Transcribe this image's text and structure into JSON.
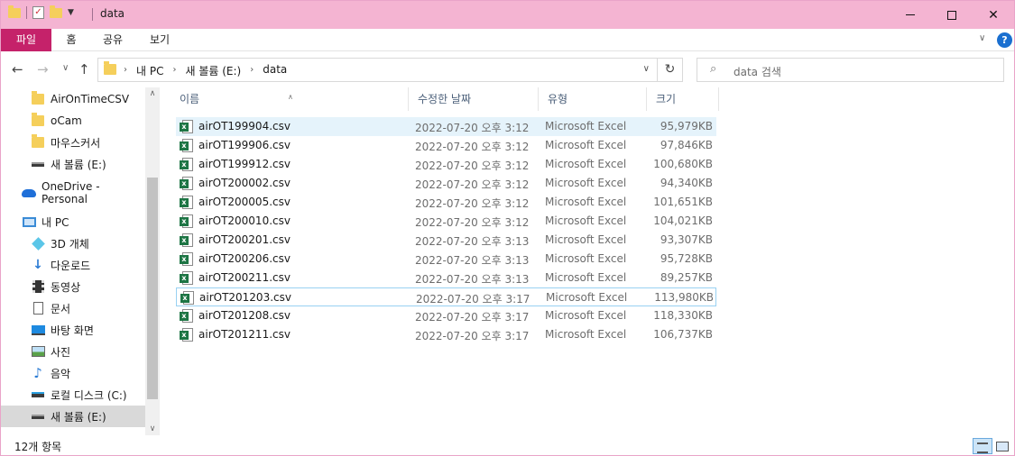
{
  "window": {
    "title": "data",
    "colors": {
      "titlebar": "#f4b4d2",
      "file_tab": "#c5226a",
      "excel_green": "#1d7544"
    }
  },
  "ribbon": {
    "file": "파일",
    "tabs": [
      "홈",
      "공유",
      "보기"
    ],
    "help": "?"
  },
  "address": {
    "crumbs": [
      "내 PC",
      "새 볼륨 (E:)",
      "data"
    ]
  },
  "search": {
    "placeholder": "data 검색"
  },
  "nav": {
    "items": [
      {
        "label": "AirOnTimeCSV",
        "icon": "folder-icon"
      },
      {
        "label": "oCam",
        "icon": "folder-icon"
      },
      {
        "label": "마우스커서",
        "icon": "folder-icon"
      },
      {
        "label": "새 볼륨 (E:)",
        "icon": "drive-icon"
      },
      {
        "label": "OneDrive - Personal",
        "icon": "onedrive-icon"
      },
      {
        "label": "내 PC",
        "icon": "pc-icon"
      },
      {
        "label": "3D 개체",
        "icon": "3d-objects-icon"
      },
      {
        "label": "다운로드",
        "icon": "downloads-icon"
      },
      {
        "label": "동영상",
        "icon": "videos-icon"
      },
      {
        "label": "문서",
        "icon": "documents-icon"
      },
      {
        "label": "바탕 화면",
        "icon": "desktop-icon"
      },
      {
        "label": "사진",
        "icon": "pictures-icon"
      },
      {
        "label": "음악",
        "icon": "music-icon"
      },
      {
        "label": "로컬 디스크 (C:)",
        "icon": "local-disk-icon"
      },
      {
        "label": "새 볼륨 (E:)",
        "icon": "drive-icon"
      }
    ]
  },
  "columns": {
    "name": "이름",
    "date": "수정한 날짜",
    "type": "유형",
    "size": "크기"
  },
  "files": [
    {
      "name": "airOT199904.csv",
      "date": "2022-07-20 오후 3:12",
      "type": "Microsoft Excel ...",
      "size": "95,979KB"
    },
    {
      "name": "airOT199906.csv",
      "date": "2022-07-20 오후 3:12",
      "type": "Microsoft Excel ...",
      "size": "97,846KB"
    },
    {
      "name": "airOT199912.csv",
      "date": "2022-07-20 오후 3:12",
      "type": "Microsoft Excel ...",
      "size": "100,680KB"
    },
    {
      "name": "airOT200002.csv",
      "date": "2022-07-20 오후 3:12",
      "type": "Microsoft Excel ...",
      "size": "94,340KB"
    },
    {
      "name": "airOT200005.csv",
      "date": "2022-07-20 오후 3:12",
      "type": "Microsoft Excel ...",
      "size": "101,651KB"
    },
    {
      "name": "airOT200010.csv",
      "date": "2022-07-20 오후 3:12",
      "type": "Microsoft Excel ...",
      "size": "104,021KB"
    },
    {
      "name": "airOT200201.csv",
      "date": "2022-07-20 오후 3:13",
      "type": "Microsoft Excel ...",
      "size": "93,307KB"
    },
    {
      "name": "airOT200206.csv",
      "date": "2022-07-20 오후 3:13",
      "type": "Microsoft Excel ...",
      "size": "95,728KB"
    },
    {
      "name": "airOT200211.csv",
      "date": "2022-07-20 오후 3:13",
      "type": "Microsoft Excel ...",
      "size": "89,257KB"
    },
    {
      "name": "airOT201203.csv",
      "date": "2022-07-20 오후 3:17",
      "type": "Microsoft Excel ...",
      "size": "113,980KB"
    },
    {
      "name": "airOT201208.csv",
      "date": "2022-07-20 오후 3:17",
      "type": "Microsoft Excel ...",
      "size": "118,330KB"
    },
    {
      "name": "airOT201211.csv",
      "date": "2022-07-20 오후 3:17",
      "type": "Microsoft Excel ...",
      "size": "106,737KB"
    }
  ],
  "status": {
    "count": "12개 항목"
  }
}
